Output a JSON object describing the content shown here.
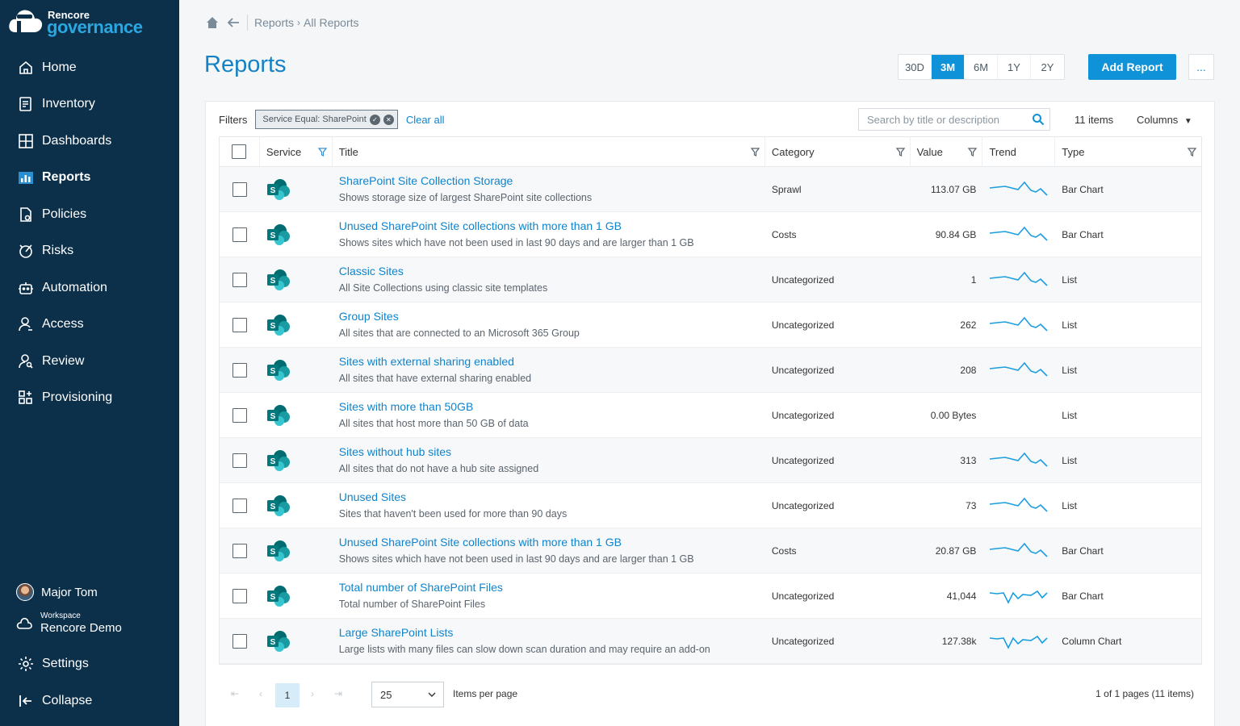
{
  "brand": {
    "name_top": "Rencore",
    "name_bottom": "governance"
  },
  "nav": [
    {
      "label": "Home",
      "icon": "home-icon",
      "active": false
    },
    {
      "label": "Inventory",
      "icon": "inventory-icon",
      "active": false
    },
    {
      "label": "Dashboards",
      "icon": "dashboards-icon",
      "active": false
    },
    {
      "label": "Reports",
      "icon": "reports-icon",
      "active": true
    },
    {
      "label": "Policies",
      "icon": "policies-icon",
      "active": false
    },
    {
      "label": "Risks",
      "icon": "risks-icon",
      "active": false
    },
    {
      "label": "Automation",
      "icon": "automation-icon",
      "active": false
    },
    {
      "label": "Access",
      "icon": "access-icon",
      "active": false
    },
    {
      "label": "Review",
      "icon": "review-icon",
      "active": false
    },
    {
      "label": "Provisioning",
      "icon": "provisioning-icon",
      "active": false
    }
  ],
  "user": {
    "name": "Major Tom"
  },
  "workspace": {
    "label": "Workspace",
    "name": "Rencore Demo"
  },
  "bottom_nav": {
    "settings": "Settings",
    "collapse": "Collapse"
  },
  "breadcrumb": {
    "section": "Reports",
    "page": "All Reports"
  },
  "page_title": "Reports",
  "periods": [
    {
      "label": "30D",
      "active": false
    },
    {
      "label": "3M",
      "active": true
    },
    {
      "label": "6M",
      "active": false
    },
    {
      "label": "1Y",
      "active": false
    },
    {
      "label": "2Y",
      "active": false
    }
  ],
  "add_report_label": "Add Report",
  "more_label": "...",
  "filters": {
    "label": "Filters",
    "chip": "Service Equal: SharePoint",
    "clear_label": "Clear all",
    "search_placeholder": "Search by title or description",
    "items_count": "11 items",
    "columns_label": "Columns"
  },
  "columns": {
    "service": "Service",
    "title": "Title",
    "category": "Category",
    "value": "Value",
    "trend": "Trend",
    "type": "Type"
  },
  "rows": [
    {
      "title": "SharePoint Site Collection Storage",
      "desc": "Shows storage size of largest SharePoint site collections",
      "category": "Sprawl",
      "value": "113.07 GB",
      "trend": "a",
      "type": "Bar Chart"
    },
    {
      "title": "Unused SharePoint Site collections with more than 1 GB",
      "desc": "Shows sites which have not been used in last 90 days and are larger than 1 GB",
      "category": "Costs",
      "value": "90.84 GB",
      "trend": "a",
      "type": "Bar Chart"
    },
    {
      "title": "Classic Sites",
      "desc": "All Site Collections using classic site templates",
      "category": "Uncategorized",
      "value": "1",
      "trend": "a",
      "type": "List"
    },
    {
      "title": "Group Sites",
      "desc": "All sites that are connected to an Microsoft 365 Group",
      "category": "Uncategorized",
      "value": "262",
      "trend": "a",
      "type": "List"
    },
    {
      "title": "Sites with external sharing enabled",
      "desc": "All sites that have external sharing enabled",
      "category": "Uncategorized",
      "value": "208",
      "trend": "a",
      "type": "List"
    },
    {
      "title": "Sites with more than 50GB",
      "desc": "All sites that host more than 50 GB of data",
      "category": "Uncategorized",
      "value": "0.00 Bytes",
      "trend": "none",
      "type": "List"
    },
    {
      "title": "Sites without hub sites",
      "desc": "All sites that do not have a hub site assigned",
      "category": "Uncategorized",
      "value": "313",
      "trend": "a",
      "type": "List"
    },
    {
      "title": "Unused Sites",
      "desc": "Sites that haven't been used for more than 90 days",
      "category": "Uncategorized",
      "value": "73",
      "trend": "a",
      "type": "List"
    },
    {
      "title": "Unused SharePoint Site collections with more than 1 GB",
      "desc": "Shows sites which have not been used in last 90 days and are larger than 1 GB",
      "category": "Costs",
      "value": "20.87 GB",
      "trend": "a",
      "type": "Bar Chart"
    },
    {
      "title": "Total number of SharePoint Files",
      "desc": "Total number of SharePoint Files",
      "category": "Uncategorized",
      "value": "41,044",
      "trend": "b",
      "type": "Bar Chart"
    },
    {
      "title": "Large SharePoint Lists",
      "desc": "Large lists with many files can slow down scan duration and may require an add-on",
      "category": "Uncategorized",
      "value": "127.38k",
      "trend": "b",
      "type": "Column Chart"
    }
  ],
  "pager": {
    "current_page": "1",
    "page_size": "25",
    "items_per_page_label": "Items per page",
    "info": "1 of 1 pages (11 items)"
  },
  "colors": {
    "sidebar": "#0c2f4a",
    "accent": "#0f92d8",
    "link": "#0f84cc",
    "sharepoint": "#036c70"
  }
}
